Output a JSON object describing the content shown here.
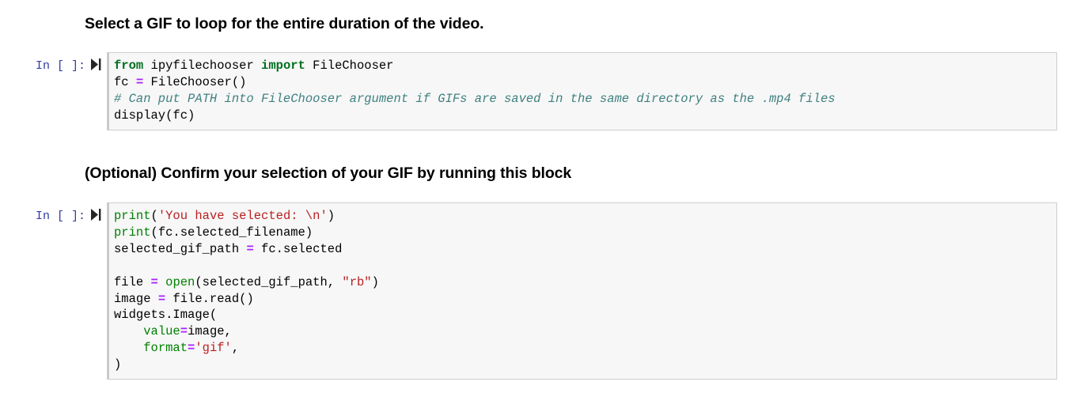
{
  "notebook": {
    "cells": [
      {
        "type": "markdown",
        "name": "heading-select-gif",
        "text": "Select a GIF to loop for the entire duration of the video."
      },
      {
        "type": "code",
        "name": "code-cell-filechooser",
        "prompt": "In [ ]:",
        "run_icon": "run-cell-icon",
        "lines": [
          [
            {
              "t": "from",
              "c": "kw"
            },
            {
              "t": " ipyfilechooser ",
              "c": "name"
            },
            {
              "t": "import",
              "c": "kw"
            },
            {
              "t": " FileChooser",
              "c": "name"
            }
          ],
          [
            {
              "t": "fc ",
              "c": "name"
            },
            {
              "t": "=",
              "c": "op"
            },
            {
              "t": " FileChooser()",
              "c": "name"
            }
          ],
          [
            {
              "t": "# Can put PATH into FileChooser argument if GIFs are saved in the same directory as the .mp4 files",
              "c": "comment"
            }
          ],
          [
            {
              "t": "display(fc)",
              "c": "name"
            }
          ]
        ]
      },
      {
        "type": "markdown",
        "name": "heading-confirm-selection",
        "text": "(Optional) Confirm your selection of your GIF by running this block"
      },
      {
        "type": "code",
        "name": "code-cell-confirm",
        "prompt": "In [ ]:",
        "run_icon": "run-cell-icon",
        "lines": [
          [
            {
              "t": "print",
              "c": "builtin"
            },
            {
              "t": "(",
              "c": "punct"
            },
            {
              "t": "'You have selected: \\n'",
              "c": "str"
            },
            {
              "t": ")",
              "c": "punct"
            }
          ],
          [
            {
              "t": "print",
              "c": "builtin"
            },
            {
              "t": "(fc.selected_filename)",
              "c": "name"
            }
          ],
          [
            {
              "t": "selected_gif_path ",
              "c": "name"
            },
            {
              "t": "=",
              "c": "op"
            },
            {
              "t": " fc.selected",
              "c": "name"
            }
          ],
          [
            {
              "t": "",
              "c": "name"
            }
          ],
          [
            {
              "t": "file ",
              "c": "name"
            },
            {
              "t": "=",
              "c": "op"
            },
            {
              "t": " ",
              "c": "name"
            },
            {
              "t": "open",
              "c": "builtin"
            },
            {
              "t": "(selected_gif_path, ",
              "c": "name"
            },
            {
              "t": "\"rb\"",
              "c": "str"
            },
            {
              "t": ")",
              "c": "punct"
            }
          ],
          [
            {
              "t": "image ",
              "c": "name"
            },
            {
              "t": "=",
              "c": "op"
            },
            {
              "t": " file.read()",
              "c": "name"
            }
          ],
          [
            {
              "t": "widgets.Image(",
              "c": "name"
            }
          ],
          [
            {
              "t": "    ",
              "c": "name"
            },
            {
              "t": "value",
              "c": "arg"
            },
            {
              "t": "=",
              "c": "op"
            },
            {
              "t": "image,",
              "c": "name"
            }
          ],
          [
            {
              "t": "    ",
              "c": "name"
            },
            {
              "t": "format",
              "c": "arg"
            },
            {
              "t": "=",
              "c": "op"
            },
            {
              "t": "'gif'",
              "c": "str"
            },
            {
              "t": ",",
              "c": "punct"
            }
          ],
          [
            {
              "t": ")",
              "c": "punct"
            }
          ]
        ]
      }
    ]
  },
  "colors": {
    "prompt": "#303F9F",
    "cell_background": "#f7f7f7",
    "cell_border": "#cfcfcf",
    "keyword": "#007020",
    "builtin": "#008000",
    "string": "#ba2121",
    "comment": "#408080",
    "operator": "#aa22ff",
    "text": "#000000"
  }
}
